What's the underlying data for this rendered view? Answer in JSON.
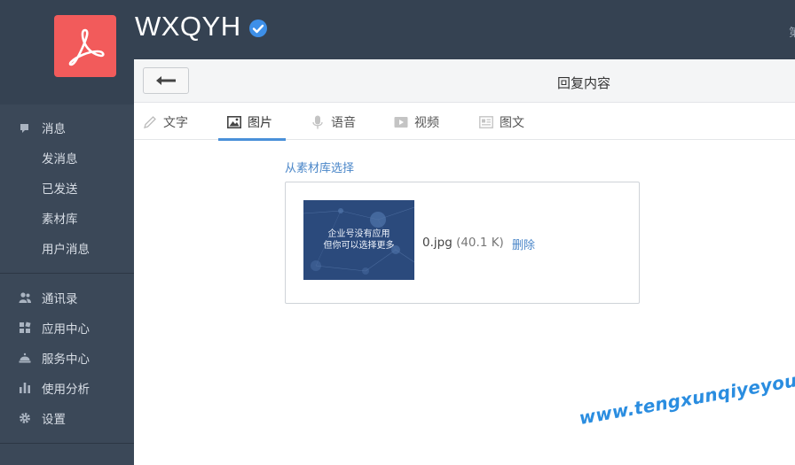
{
  "header": {
    "app_title": "WXQYH",
    "corner_text": "第"
  },
  "sidebar": {
    "groups": [
      {
        "items": [
          {
            "label": "消息",
            "icon": "message-icon"
          },
          {
            "label": "发消息"
          },
          {
            "label": "已发送"
          },
          {
            "label": "素材库"
          },
          {
            "label": "用户消息"
          }
        ]
      },
      {
        "items": [
          {
            "label": "通讯录",
            "icon": "contacts-icon"
          },
          {
            "label": "应用中心",
            "icon": "apps-icon"
          },
          {
            "label": "服务中心",
            "icon": "service-bell-icon"
          },
          {
            "label": "使用分析",
            "icon": "bar-chart-icon"
          },
          {
            "label": "设置",
            "icon": "gear-icon"
          }
        ]
      }
    ]
  },
  "panel": {
    "title": "回复内容",
    "tabs": [
      {
        "label": "文字",
        "icon": "pencil-icon"
      },
      {
        "label": "图片",
        "icon": "image-icon",
        "active": true
      },
      {
        "label": "语音",
        "icon": "microphone-icon"
      },
      {
        "label": "视频",
        "icon": "video-icon"
      },
      {
        "label": "图文",
        "icon": "article-icon"
      }
    ],
    "library_link": "从素材库选择",
    "attachment": {
      "thumb_line1": "企业号没有应用",
      "thumb_line2": "但你可以选择更多",
      "file_name": "0.jpg",
      "file_size": "(40.1 K)",
      "delete_label": "删除"
    }
  },
  "watermark": "www.tengxunqiyeyou.com",
  "colors": {
    "header_bg": "#354252",
    "sidebar_bg": "#3b4858",
    "logo_bg": "#f25b5b",
    "accent": "#4a90d9",
    "link": "#4a86c8"
  }
}
